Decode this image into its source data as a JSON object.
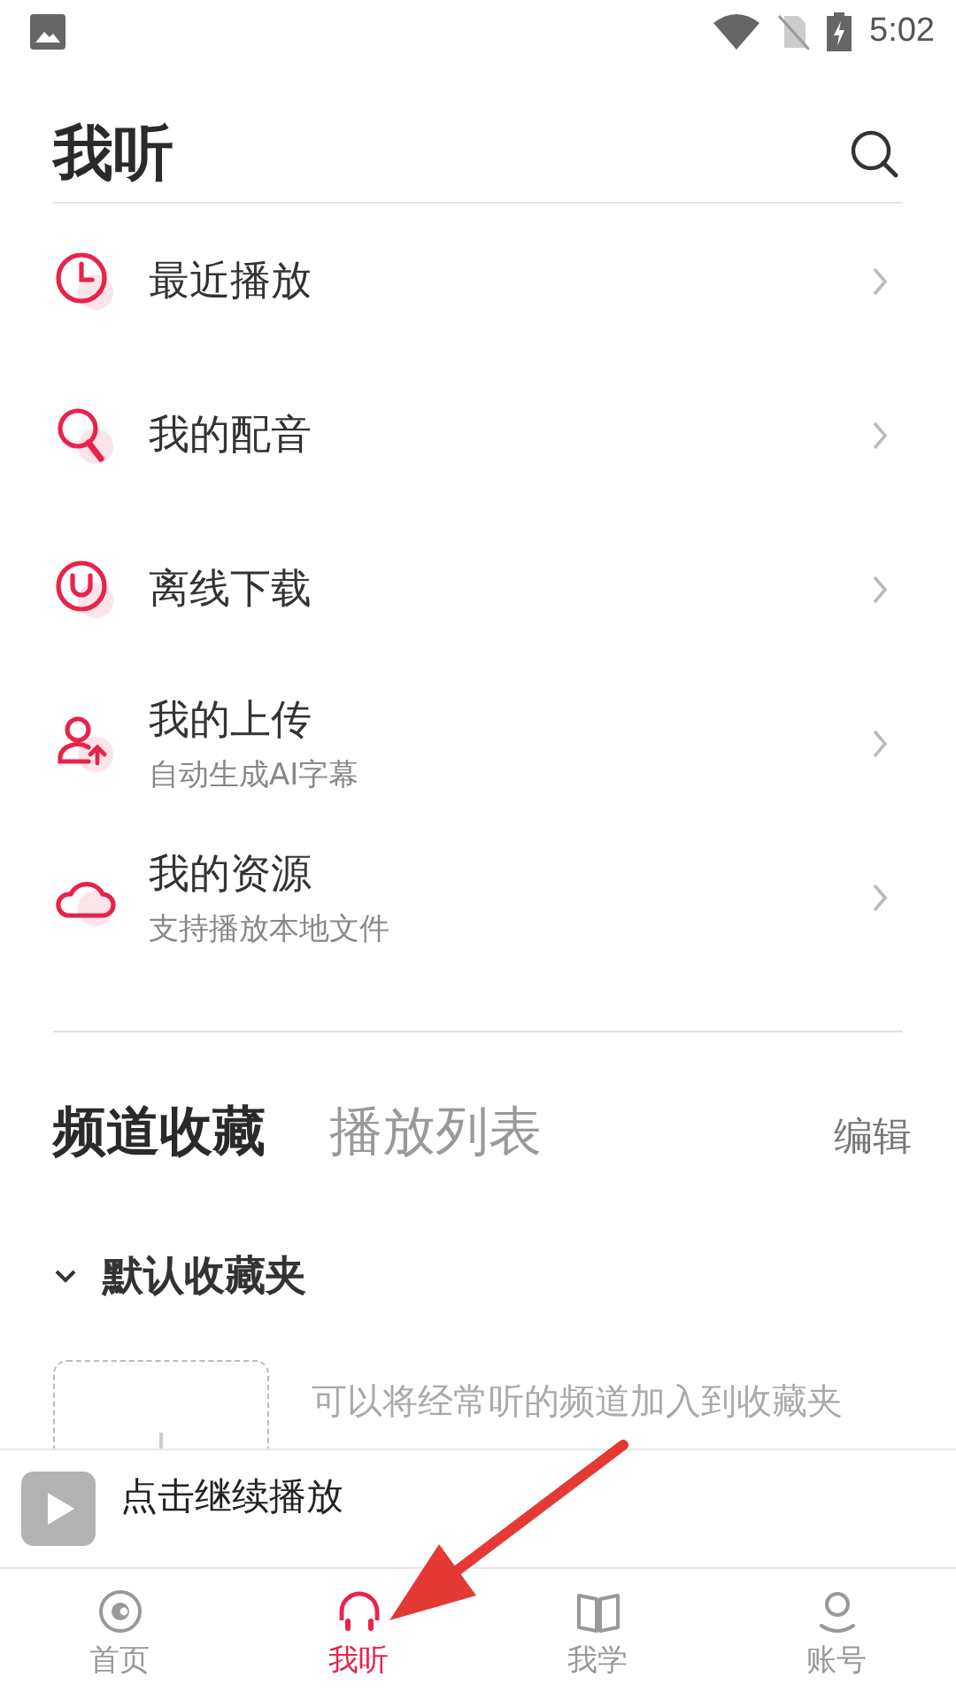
{
  "status_bar": {
    "time": "5:02"
  },
  "header": {
    "title": "我听"
  },
  "menu": [
    {
      "kind": "clock",
      "title": "最近播放"
    },
    {
      "kind": "dubbing",
      "title": "我的配音"
    },
    {
      "kind": "offline",
      "title": "离线下载"
    },
    {
      "kind": "upload",
      "title": "我的上传",
      "subtitle": "自动生成AI字幕"
    },
    {
      "kind": "cloud",
      "title": "我的资源",
      "subtitle": "支持播放本地文件"
    }
  ],
  "section_tabs": [
    {
      "label": "频道收藏",
      "selected": true
    },
    {
      "label": "播放列表",
      "selected": false
    }
  ],
  "edit_button": "编辑",
  "folders": [
    {
      "name": "默认收藏夹",
      "expanded": true,
      "empty_hint": "可以将经常听的频道加入到收藏夹"
    }
  ],
  "mini_player": {
    "text": "点击继续播放"
  },
  "bottom_nav": [
    {
      "kind": "home",
      "label": "首页",
      "selected": false
    },
    {
      "kind": "listen",
      "label": "我听",
      "selected": true
    },
    {
      "kind": "learn",
      "label": "我学",
      "selected": false
    },
    {
      "kind": "account",
      "label": "账号",
      "selected": false
    }
  ]
}
